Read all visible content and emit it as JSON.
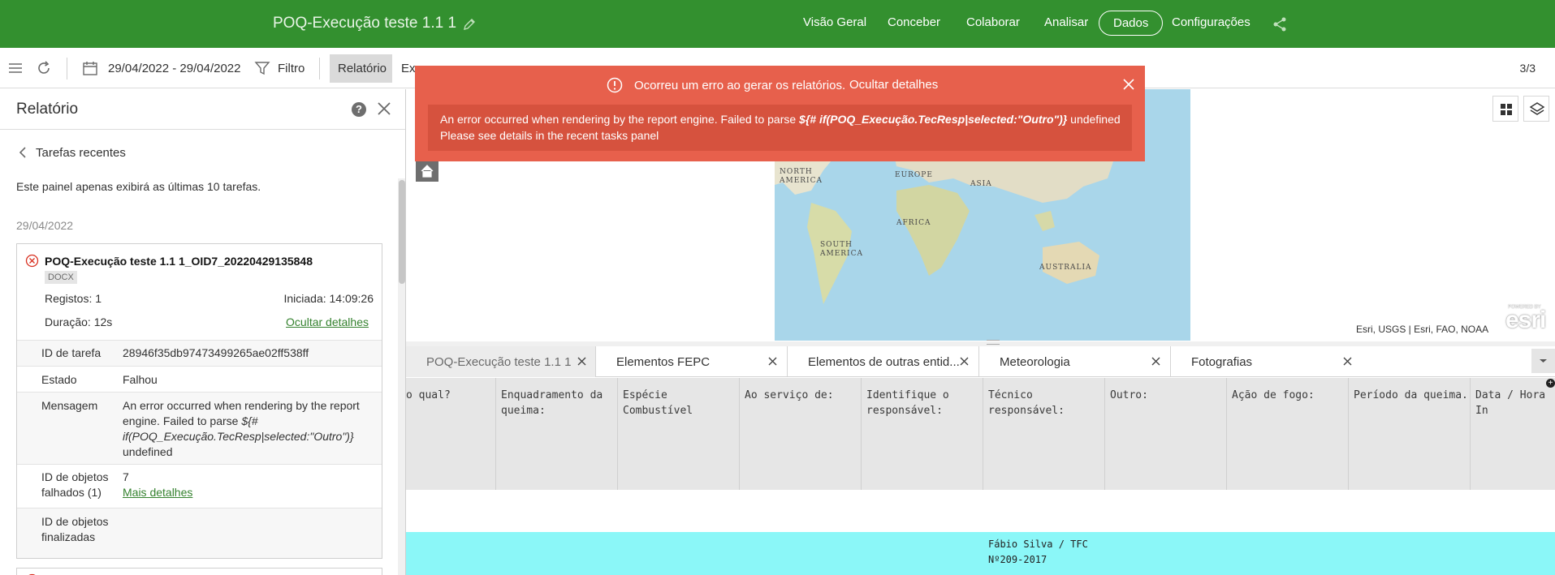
{
  "header": {
    "title": "POQ-Execução teste 1.1 1",
    "nav": [
      "Visão Geral",
      "Conceber",
      "Colaborar",
      "Analisar",
      "Dados",
      "Configurações"
    ],
    "active_nav": "Dados"
  },
  "toolbar": {
    "date_range": "29/04/2022 - 29/04/2022",
    "filter_label": "Filtro",
    "report_label": "Relatório",
    "export_label": "Ex",
    "count": "3/3"
  },
  "panel": {
    "title": "Relatório",
    "back_label": "Tarefas recentes",
    "note": "Este painel apenas exibirá as últimas 10 tarefas.",
    "date": "29/04/2022",
    "task": {
      "name": "POQ-Execução teste 1.1 1_OID7_20220429135848",
      "format": "DOCX",
      "records_label": "Registos: 1",
      "started_label": "Iniciada: 14:09:26",
      "duration_label": "Duração: 12s",
      "hide_details": "Ocultar detalhes",
      "details": {
        "task_id_label": "ID de tarefa",
        "task_id": "28946f35db97473499265ae02ff538ff",
        "state_label": "Estado",
        "state": "Falhou",
        "message_label": "Mensagem",
        "message_prefix": "An error occurred when rendering by the report engine. Failed to parse ",
        "message_expr": "${# if(POQ_Execução.TecResp|selected:\"Outro\")}",
        "message_suffix": " undefined",
        "failed_label_1": "ID de objetos",
        "failed_label_2": "falhados (1)",
        "failed_value": "7",
        "more_details": "Mais detalhes",
        "finished_label_1": "ID de objetos",
        "finished_label_2": "finalizadas"
      }
    }
  },
  "error_banner": {
    "title": "Ocorreu um erro ao gerar os relatórios.",
    "toggle": "Ocultar detalhes",
    "line1_prefix": "An error occurred when rendering by the report engine. Failed to parse ",
    "line1_expr": "${# if(POQ_Execução.TecResp|selected:\"Outro\")}",
    "line1_suffix": " undefined",
    "line2": "Please see details in the recent tasks panel"
  },
  "map": {
    "labels": {
      "north_america_1": "NORTH",
      "north_america_2": "AMERICA",
      "europe": "EUROPE",
      "asia": "ASIA",
      "africa": "AFRICA",
      "south_america_1": "SOUTH",
      "south_america_2": "AMERICA",
      "australia": "AUSTRALIA"
    },
    "attribution": "Esri, USGS | Esri, FAO, NOAA",
    "logo": "esri",
    "logo_small": "POWERED BY"
  },
  "tabs": [
    {
      "label": "POQ-Execução teste 1.1 1"
    },
    {
      "label": "Elementos FEPC"
    },
    {
      "label": "Elementos de outras entid..."
    },
    {
      "label": "Meteorologia"
    },
    {
      "label": "Fotografias"
    }
  ],
  "table": {
    "columns": [
      [
        "o qual?",
        ""
      ],
      [
        "Enquadramento da",
        "queima:"
      ],
      [
        "Espécie",
        "Combustível"
      ],
      [
        "Ao serviço de:",
        ""
      ],
      [
        "Identifique o",
        "responsável:"
      ],
      [
        "Técnico",
        "responsável:"
      ],
      [
        "Outro:",
        ""
      ],
      [
        "Ação de fogo:",
        ""
      ],
      [
        "Período da queima.",
        ""
      ],
      [
        "Data / Hora In",
        ""
      ]
    ],
    "cell_line1": "Fábio Silva / TFC",
    "cell_line2": "Nº209-2017"
  },
  "colors": {
    "header_green": "#33902f",
    "error_red": "#e7604c",
    "link_green": "#35822f",
    "row_highlight": "#8bf7f8"
  }
}
